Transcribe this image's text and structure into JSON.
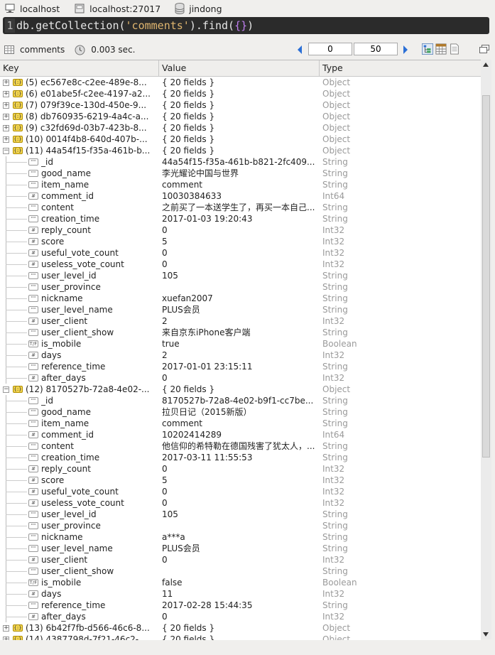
{
  "topbar": {
    "host": "localhost",
    "server": "localhost:27017",
    "database": "jindong"
  },
  "query": {
    "line_no": "1",
    "prefix": "db.getCollection(",
    "collection_arg": "'comments'",
    "mid": ").find(",
    "braces": "{}",
    "suffix": ")"
  },
  "result_bar": {
    "collection": "comments",
    "time": "0.003 sec.",
    "page_start": "0",
    "page_size": "50"
  },
  "columns": {
    "key": "Key",
    "value": "Value",
    "type": "Type"
  },
  "rows": [
    {
      "key": "(5) ec567e8c-c2ee-489e-8...",
      "value": "{ 20 fields }",
      "type": "Object"
    },
    {
      "key": "(6) e01abe5f-c2ee-4197-a2...",
      "value": "{ 20 fields }",
      "type": "Object"
    },
    {
      "key": "(7) 079f39ce-130d-450e-9...",
      "value": "{ 20 fields }",
      "type": "Object"
    },
    {
      "key": "(8) db760935-6219-4a4c-a...",
      "value": "{ 20 fields }",
      "type": "Object"
    },
    {
      "key": "(9) c32fd69d-03b7-423b-8...",
      "value": "{ 20 fields }",
      "type": "Object"
    },
    {
      "key": "(10) 0014f4b8-640d-407b-...",
      "value": "{ 20 fields }",
      "type": "Object"
    },
    {
      "key": "(11) 44a54f15-f35a-461b-b...",
      "value": "{ 20 fields }",
      "type": "Object"
    },
    {
      "key": "_id",
      "value": "44a54f15-f35a-461b-b821-2fc409...",
      "type": "String"
    },
    {
      "key": "good_name",
      "value": "李光耀论中国与世界",
      "type": "String"
    },
    {
      "key": "item_name",
      "value": "comment",
      "type": "String"
    },
    {
      "key": "comment_id",
      "value": "10030384633",
      "type": "Int64"
    },
    {
      "key": "content",
      "value": "之前买了一本送学生了，再买一本自己...",
      "type": "String"
    },
    {
      "key": "creation_time",
      "value": "2017-01-03 19:20:43",
      "type": "String"
    },
    {
      "key": "reply_count",
      "value": "0",
      "type": "Int32"
    },
    {
      "key": "score",
      "value": "5",
      "type": "Int32"
    },
    {
      "key": "useful_vote_count",
      "value": "0",
      "type": "Int32"
    },
    {
      "key": "useless_vote_count",
      "value": "0",
      "type": "Int32"
    },
    {
      "key": "user_level_id",
      "value": "105",
      "type": "String"
    },
    {
      "key": "user_province",
      "value": "",
      "type": "String"
    },
    {
      "key": "nickname",
      "value": "xuefan2007",
      "type": "String"
    },
    {
      "key": "user_level_name",
      "value": "PLUS会员",
      "type": "String"
    },
    {
      "key": "user_client",
      "value": "2",
      "type": "Int32"
    },
    {
      "key": "user_client_show",
      "value": "来自京东iPhone客户端",
      "type": "String"
    },
    {
      "key": "is_mobile",
      "value": "true",
      "type": "Boolean"
    },
    {
      "key": "days",
      "value": "2",
      "type": "Int32"
    },
    {
      "key": "reference_time",
      "value": "2017-01-01 23:15:11",
      "type": "String"
    },
    {
      "key": "after_days",
      "value": "0",
      "type": "Int32"
    },
    {
      "key": "(12) 8170527b-72a8-4e02-...",
      "value": "{ 20 fields }",
      "type": "Object"
    },
    {
      "key": "_id",
      "value": "8170527b-72a8-4e02-b9f1-cc7be...",
      "type": "String"
    },
    {
      "key": "good_name",
      "value": "拉贝日记（2015新版）",
      "type": "String"
    },
    {
      "key": "item_name",
      "value": "comment",
      "type": "String"
    },
    {
      "key": "comment_id",
      "value": "10202414289",
      "type": "Int64"
    },
    {
      "key": "content",
      "value": "他信仰的希特勒在德国残害了犹太人，...",
      "type": "String"
    },
    {
      "key": "creation_time",
      "value": "2017-03-11 11:55:53",
      "type": "String"
    },
    {
      "key": "reply_count",
      "value": "0",
      "type": "Int32"
    },
    {
      "key": "score",
      "value": "5",
      "type": "Int32"
    },
    {
      "key": "useful_vote_count",
      "value": "0",
      "type": "Int32"
    },
    {
      "key": "useless_vote_count",
      "value": "0",
      "type": "Int32"
    },
    {
      "key": "user_level_id",
      "value": "105",
      "type": "String"
    },
    {
      "key": "user_province",
      "value": "",
      "type": "String"
    },
    {
      "key": "nickname",
      "value": "a***a",
      "type": "String"
    },
    {
      "key": "user_level_name",
      "value": "PLUS会员",
      "type": "String"
    },
    {
      "key": "user_client",
      "value": "0",
      "type": "Int32"
    },
    {
      "key": "user_client_show",
      "value": "",
      "type": "String"
    },
    {
      "key": "is_mobile",
      "value": "false",
      "type": "Boolean"
    },
    {
      "key": "days",
      "value": "11",
      "type": "Int32"
    },
    {
      "key": "reference_time",
      "value": "2017-02-28 15:44:35",
      "type": "String"
    },
    {
      "key": "after_days",
      "value": "0",
      "type": "Int32"
    },
    {
      "key": "(13) 6b42f7fb-d566-46c6-8...",
      "value": "{ 20 fields }",
      "type": "Object"
    },
    {
      "key": "(14) 4387798d-7f21-46c2-...",
      "value": "{ 20 fields }",
      "type": "Object"
    }
  ],
  "colors": {
    "query_bg": "#2b2b2b",
    "type_text": "#9a9a9a",
    "object_icon": "#f3d54e",
    "nav_arrow": "#2a6fd6"
  }
}
